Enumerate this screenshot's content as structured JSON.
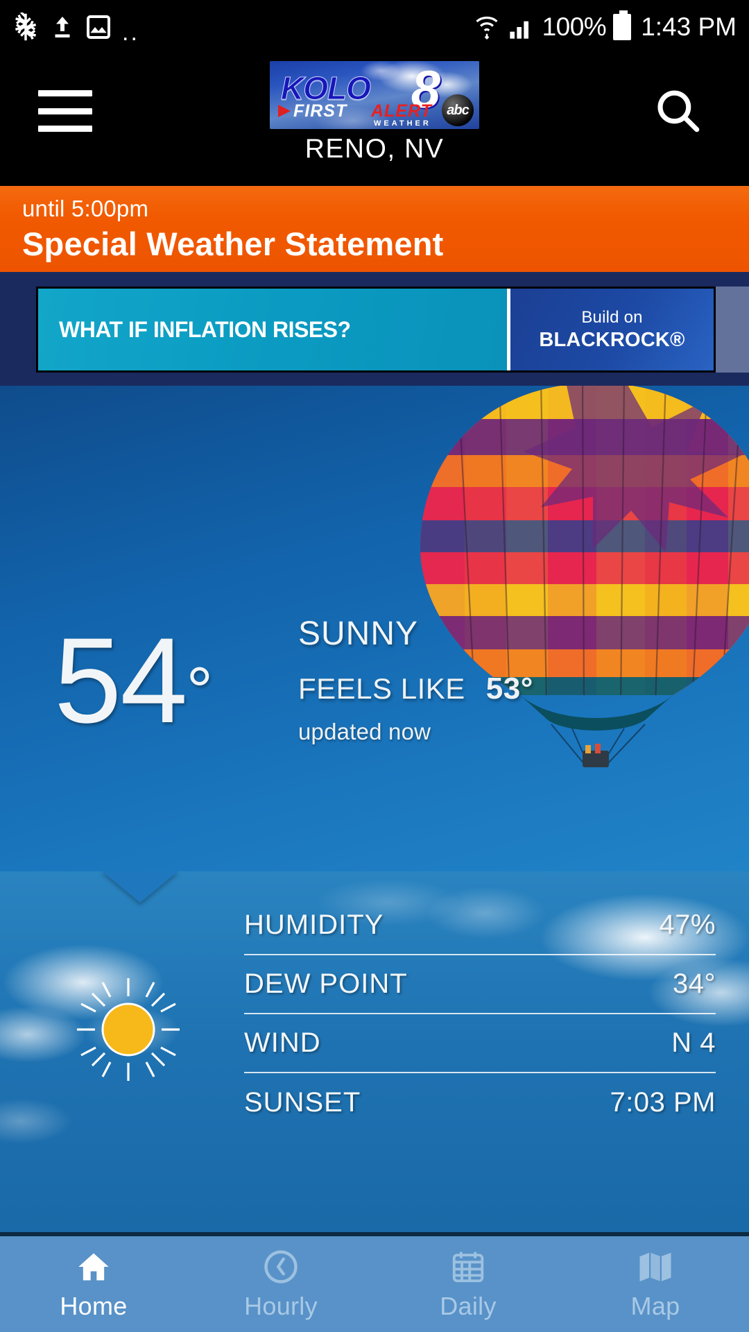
{
  "status_bar": {
    "icons": [
      "snowflake-icon",
      "upload-icon",
      "image-icon",
      "more-icon"
    ],
    "dots": "..",
    "wifi": "wifi-icon",
    "signal": "cellular-signal-icon",
    "battery_percent": "100%",
    "time": "1:43 PM"
  },
  "header": {
    "menu_icon": "hamburger-menu-icon",
    "search_icon": "search-icon",
    "logo": {
      "call_sign": "KOLO",
      "channel": "8",
      "network": "abc",
      "first": "FIRST",
      "alert": "ALERT",
      "weather": "WEATHER"
    },
    "location": "RENO, NV"
  },
  "alert": {
    "until": "until 5:00pm",
    "title": "Special Weather Statement",
    "color": "#f05a00"
  },
  "ad": {
    "headline": "WHAT IF INFLATION RISES?",
    "build_on": "Build on",
    "brand": "BLACKROCK®"
  },
  "current": {
    "temperature": "54",
    "degree": "°",
    "condition": "SUNNY",
    "feels_like_label": "FEELS LIKE",
    "feels_like_value": "53°",
    "updated": "updated now"
  },
  "details": {
    "icon": "sun-icon",
    "rows": [
      {
        "label": "HUMIDITY",
        "value": "47%"
      },
      {
        "label": "DEW POINT",
        "value": "34°"
      },
      {
        "label": "WIND",
        "value": "N 4"
      },
      {
        "label": "SUNSET",
        "value": "7:03 PM"
      }
    ]
  },
  "nav": {
    "items": [
      {
        "label": "Home",
        "icon": "home-icon",
        "active": true
      },
      {
        "label": "Hourly",
        "icon": "clock-icon",
        "active": false
      },
      {
        "label": "Daily",
        "icon": "calendar-icon",
        "active": false
      },
      {
        "label": "Map",
        "icon": "map-icon",
        "active": false
      }
    ]
  }
}
